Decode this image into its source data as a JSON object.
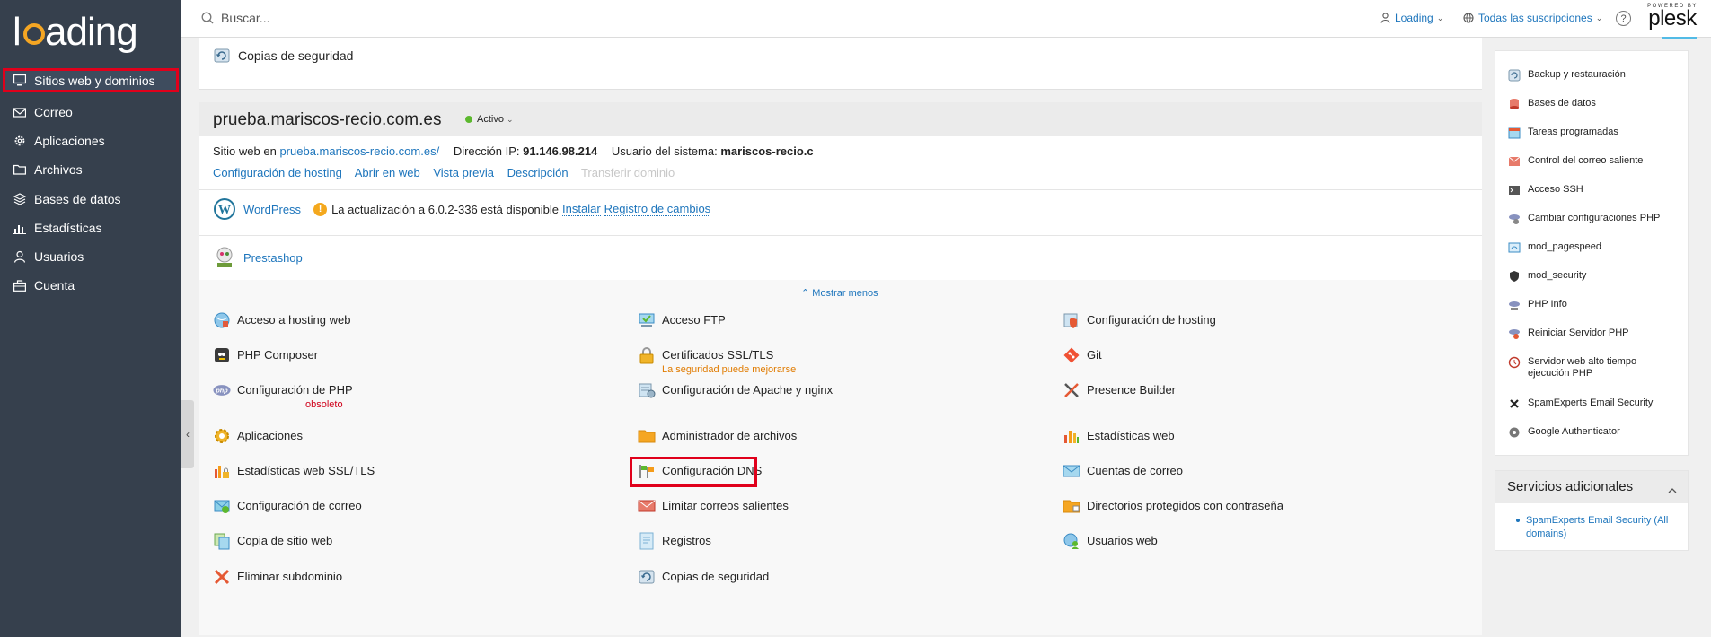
{
  "brand": {
    "logo_text": "loading",
    "logo_letters": [
      "l",
      "o",
      "a",
      "d",
      "i",
      "n",
      "g"
    ]
  },
  "sidebar": {
    "items": [
      {
        "label": "Sitios web y dominios",
        "icon": "monitor-icon",
        "active": true
      },
      {
        "label": "Correo",
        "icon": "envelope-icon"
      },
      {
        "label": "Aplicaciones",
        "icon": "gear-icon"
      },
      {
        "label": "Archivos",
        "icon": "folder-icon"
      },
      {
        "label": "Bases de datos",
        "icon": "layers-icon"
      },
      {
        "label": "Estadísticas",
        "icon": "bar-chart-icon"
      },
      {
        "label": "Usuarios",
        "icon": "user-icon"
      },
      {
        "label": "Cuenta",
        "icon": "briefcase-icon"
      }
    ]
  },
  "topbar": {
    "search_placeholder": "Buscar...",
    "user_label": "Loading",
    "subscriptions_label": "Todas las suscripciones",
    "help_label": "?",
    "powered_by": "POWERED BY",
    "plesk": "plesk"
  },
  "top_card": {
    "label": "Copias de seguridad"
  },
  "domain": {
    "name": "prueba.mariscos-recio.com.es",
    "status": "Activo",
    "site_prefix": "Sitio web en",
    "site_url": "prueba.mariscos-recio.com.es/",
    "ip_label": "Dirección IP:",
    "ip": "91.146.98.214",
    "user_label": "Usuario del sistema:",
    "user": "mariscos-recio.c",
    "links": [
      "Configuración de hosting",
      "Abrir en web",
      "Vista previa",
      "Descripción"
    ],
    "disabled_link": "Transferir dominio",
    "wordpress": {
      "name": "WordPress",
      "update_text": "La actualización a 6.0.2-336 está disponible",
      "install": "Instalar",
      "changelog": "Registro de cambios"
    },
    "prestashop": {
      "name": "Prestashop"
    },
    "show_less": "Mostrar menos",
    "tools": {
      "col1": [
        {
          "label": "Acceso a hosting web",
          "icon": "globe-key-icon"
        },
        {
          "label": "PHP Composer",
          "icon": "php-composer-icon"
        },
        {
          "label": "Configuración de PHP",
          "icon": "php-icon",
          "note": "obsoleto",
          "note_color": "#d0021b"
        },
        {
          "label": "Aplicaciones",
          "icon": "gear-icon"
        },
        {
          "label": "Estadísticas web SSL/TLS",
          "icon": "stats-lock-icon"
        },
        {
          "label": "Configuración de correo",
          "icon": "mail-settings-icon"
        },
        {
          "label": "Copia de sitio web",
          "icon": "copy-site-icon"
        },
        {
          "label": "Eliminar subdominio",
          "icon": "delete-icon"
        }
      ],
      "col2": [
        {
          "label": "Acceso FTP",
          "icon": "ftp-icon"
        },
        {
          "label": "Certificados SSL/TLS",
          "icon": "lock-icon",
          "note": "La seguridad puede mejorarse",
          "note_color": "#e07b00"
        },
        {
          "label": "Configuración de Apache y nginx",
          "icon": "server-settings-icon"
        },
        {
          "label": "Administrador de archivos",
          "icon": "folder-icon"
        },
        {
          "label": "Configuración DNS",
          "icon": "dns-flags-icon",
          "highlight": true
        },
        {
          "label": "Limitar correos salientes",
          "icon": "mail-limit-icon"
        },
        {
          "label": "Registros",
          "icon": "logs-icon"
        },
        {
          "label": "Copias de seguridad",
          "icon": "backup-icon"
        }
      ],
      "col3": [
        {
          "label": "Configuración de hosting",
          "icon": "hosting-settings-icon"
        },
        {
          "label": "Git",
          "icon": "git-icon"
        },
        {
          "label": "Presence Builder",
          "icon": "tools-icon"
        },
        {
          "label": "Estadísticas web",
          "icon": "bar-chart-icon"
        },
        {
          "label": "Cuentas de correo",
          "icon": "envelope-icon"
        },
        {
          "label": "Directorios protegidos con contraseña",
          "icon": "protected-folder-icon"
        },
        {
          "label": "Usuarios web",
          "icon": "web-users-icon"
        }
      ]
    }
  },
  "right_panel": {
    "items": [
      {
        "label": "Backup y restauración",
        "icon": "backup-icon"
      },
      {
        "label": "Bases de datos",
        "icon": "database-icon"
      },
      {
        "label": "Tareas programadas",
        "icon": "calendar-icon"
      },
      {
        "label": "Control del correo saliente",
        "icon": "mail-control-icon"
      },
      {
        "label": "Acceso SSH",
        "icon": "terminal-icon"
      },
      {
        "label": "Cambiar configuraciones PHP",
        "icon": "php-settings-icon"
      },
      {
        "label": "mod_pagespeed",
        "icon": "pagespeed-icon"
      },
      {
        "label": "mod_security",
        "icon": "shield-icon"
      },
      {
        "label": "PHP Info",
        "icon": "php-info-icon"
      },
      {
        "label": "Reiniciar Servidor PHP",
        "icon": "restart-icon"
      },
      {
        "label": "Servidor web alto tiempo ejecución PHP",
        "icon": "timer-icon"
      },
      {
        "label": "SpamExperts Email Security",
        "icon": "spamexperts-icon"
      },
      {
        "label": "Google Authenticator",
        "icon": "authenticator-icon"
      }
    ]
  },
  "services": {
    "title": "Servicios adicionales",
    "items": [
      "SpamExperts Email Security (All domains)"
    ]
  },
  "colors": {
    "sidebar": "#36404d",
    "link": "#1d75bc",
    "highlight": "#e0001b",
    "active_status": "#5cb82e"
  }
}
